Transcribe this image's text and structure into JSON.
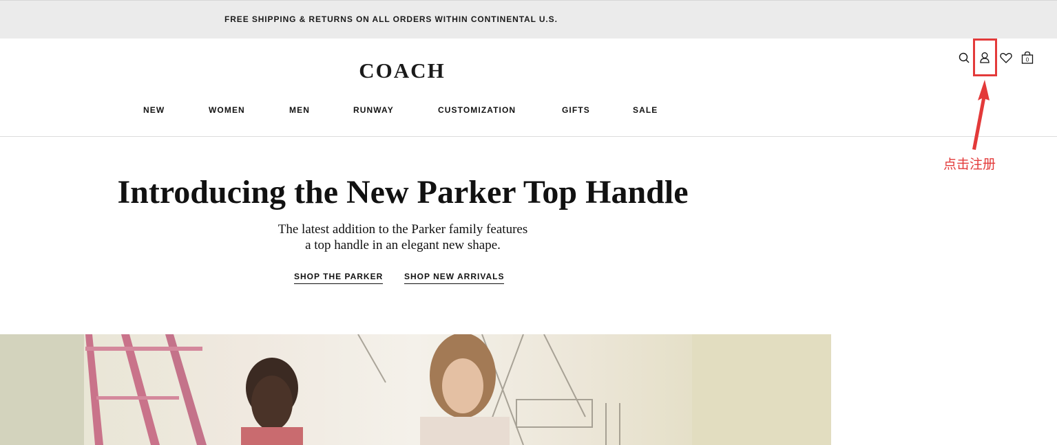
{
  "promo": {
    "text": "FREE SHIPPING & RETURNS ON ALL ORDERS WITHIN CONTINENTAL U.S."
  },
  "header": {
    "logo": "COACH",
    "nav": [
      "NEW",
      "WOMEN",
      "MEN",
      "RUNWAY",
      "CUSTOMIZATION",
      "GIFTS",
      "SALE"
    ],
    "icons": [
      "search-icon",
      "account-icon",
      "wishlist-heart-icon",
      "shopping-bag-icon"
    ],
    "bag_count": "0"
  },
  "annotation": {
    "label": "点击注册",
    "color": "#e33a3a"
  },
  "hero": {
    "title": "Introducing the New Parker Top Handle",
    "subtitle_line1": "The latest addition to the Parker family features",
    "subtitle_line2": "a top handle in an elegant new shape.",
    "cta_primary": "SHOP THE PARKER",
    "cta_secondary": "SHOP NEW ARRIVALS"
  }
}
